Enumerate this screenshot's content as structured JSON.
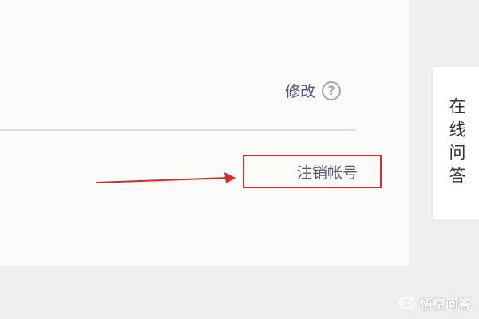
{
  "account": {
    "modify_label": "修改",
    "help_icon": "?",
    "deactivate_label": "注销帐号"
  },
  "sidebar": {
    "online_qa_label": "在线问答"
  },
  "watermark": {
    "text": "悟空问答"
  },
  "colors": {
    "highlight_border": "#d82a2a",
    "link_text": "#52577a",
    "arrow": "#d82a2a"
  },
  "icons": {
    "help": "question-circle-icon",
    "watermark": "wukong-logo-icon"
  }
}
